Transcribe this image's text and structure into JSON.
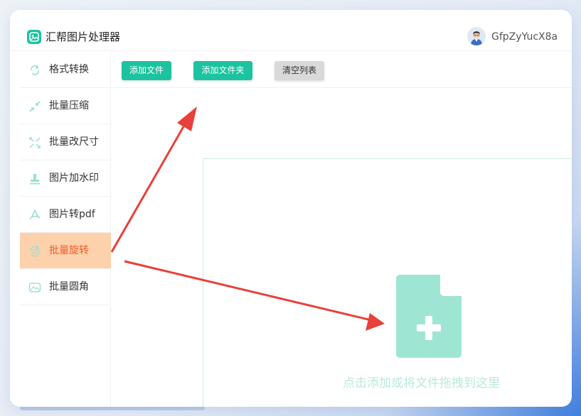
{
  "app": {
    "title": "汇帮图片处理器",
    "username": "GfpZyYucX8a"
  },
  "colors": {
    "accent": "#1cc3a0",
    "active_bg": "#fdd1ab",
    "active_text": "#f25a2b",
    "annotation_arrow": "#e8403a"
  },
  "sidebar": {
    "items": [
      {
        "label": "格式转换",
        "icon": "format-convert-icon",
        "active": false
      },
      {
        "label": "批量压缩",
        "icon": "compress-icon",
        "active": false
      },
      {
        "label": "批量改尺寸",
        "icon": "resize-icon",
        "active": false
      },
      {
        "label": "图片加水印",
        "icon": "watermark-icon",
        "active": false
      },
      {
        "label": "图片转pdf",
        "icon": "pdf-icon",
        "active": false
      },
      {
        "label": "批量旋转",
        "icon": "rotate-icon",
        "active": true
      },
      {
        "label": "批量圆角",
        "icon": "rounded-corner-icon",
        "active": false
      }
    ]
  },
  "toolbar": {
    "add_file": "添加文件",
    "add_folder": "添加文件夹",
    "clear_list": "清空列表"
  },
  "dropzone": {
    "hint": "点击添加或将文件拖拽到这里",
    "icon": "add-file-icon"
  }
}
